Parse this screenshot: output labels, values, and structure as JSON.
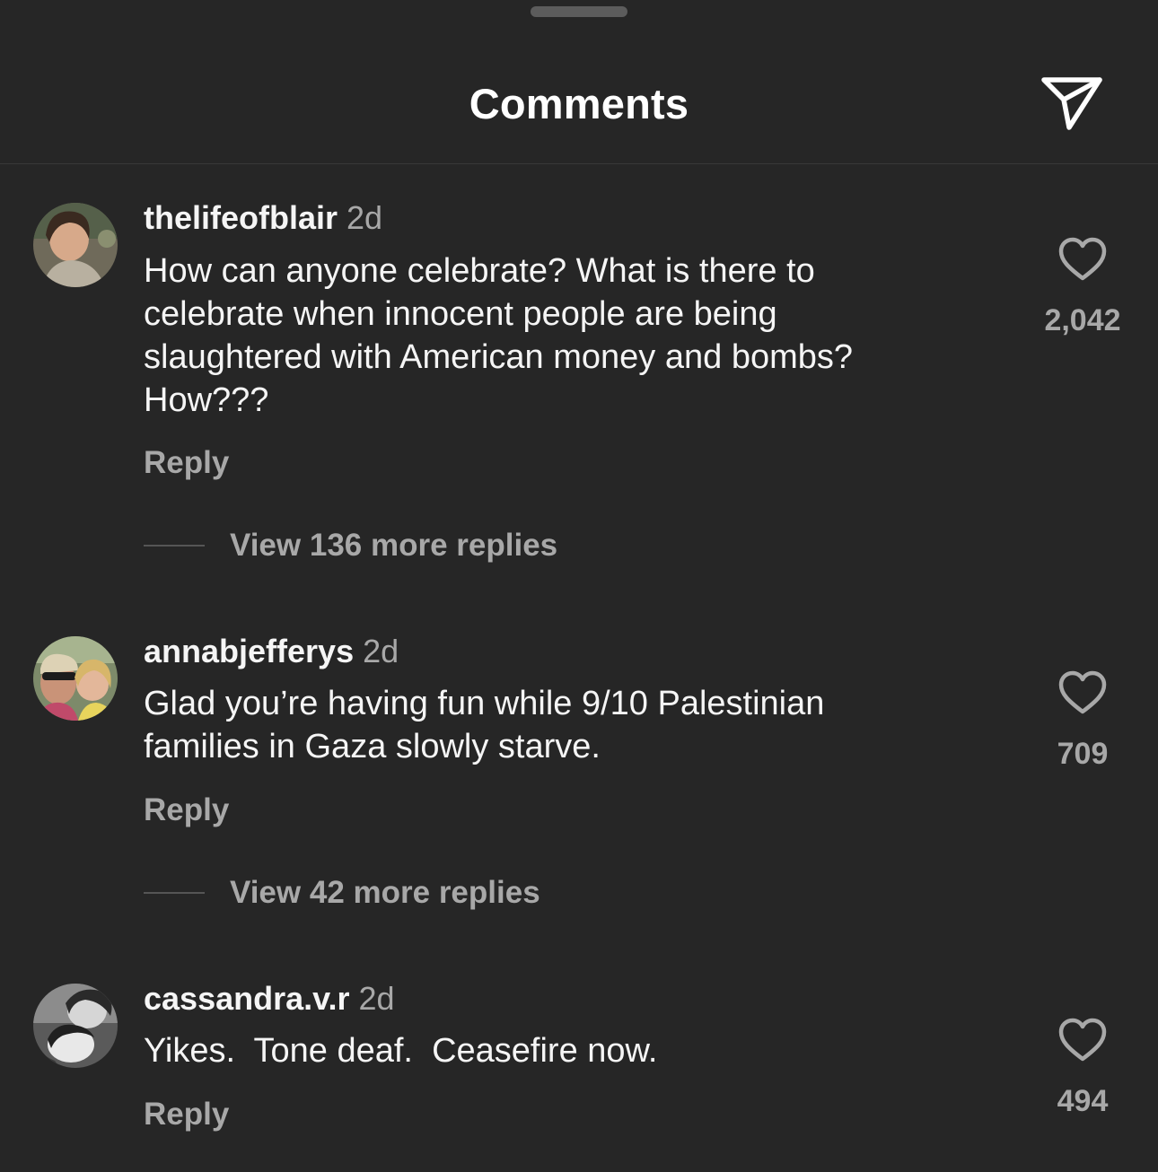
{
  "header": {
    "title": "Comments",
    "share_icon": "send-paper-plane-icon"
  },
  "comments": [
    {
      "username": "thelifeofblair",
      "time": "2d",
      "text_lines": [
        "How can anyone celebrate? What is there to",
        "celebrate when innocent people are being",
        "slaughtered with American money and bombs?",
        "How???"
      ],
      "reply_label": "Reply",
      "view_replies_label": "View 136 more replies",
      "likes": "2,042",
      "like_icon": "heart-outline-icon"
    },
    {
      "username": "annabjefferys",
      "time": "2d",
      "text_lines": [
        "Glad you’re having fun while 9/10 Palestinian",
        "families in Gaza slowly starve."
      ],
      "reply_label": "Reply",
      "view_replies_label": "View 42 more replies",
      "likes": "709",
      "like_icon": "heart-outline-icon"
    },
    {
      "username": "cassandra.v.r",
      "time": "2d",
      "text_lines": [
        "Yikes.  Tone deaf.  Ceasefire now."
      ],
      "reply_label": "Reply",
      "likes": "494",
      "like_icon": "heart-outline-icon"
    }
  ],
  "colors": {
    "background": "#262626",
    "primary_text": "#f5f5f5",
    "secondary_text": "#a8a8a8"
  }
}
